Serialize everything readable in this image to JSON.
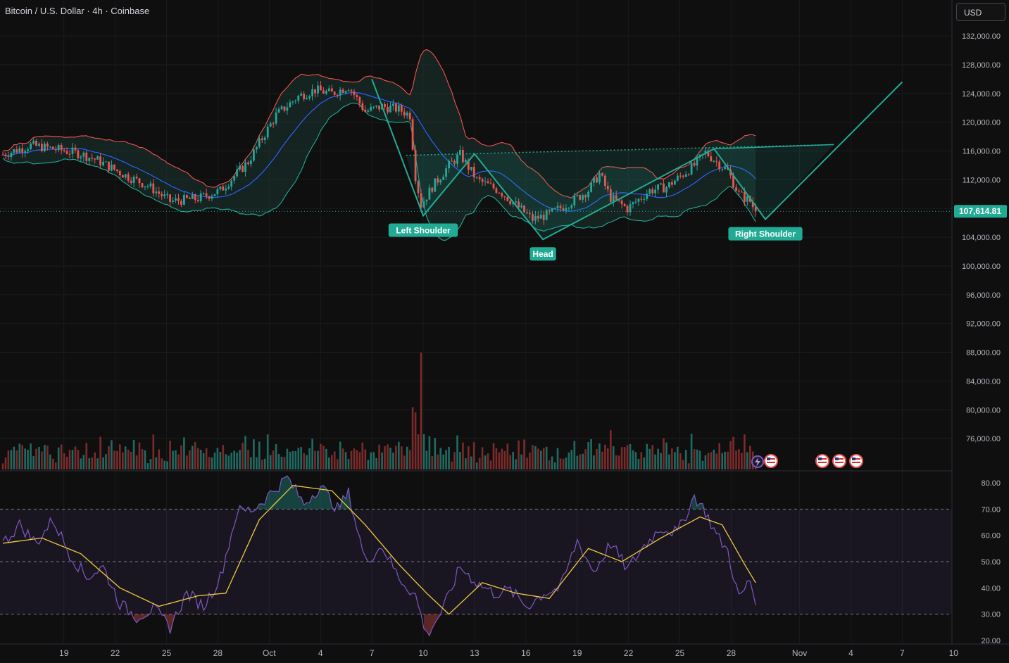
{
  "header": {
    "symbol_title": "Bitcoin / U.S. Dollar · 4h · Coinbase",
    "currency": "USD"
  },
  "colors": {
    "up": "#26a69a",
    "down": "#ef5350",
    "ma": "#2962ff",
    "band": "#ef5350",
    "pattern": "#22ab94",
    "rsi": "#7e57c2",
    "rsi_ma": "#f0c93a",
    "background": "#0f0f0f"
  },
  "last_price": "107,614.81",
  "pattern_labels": {
    "left_shoulder": "Left Shoulder",
    "head": "Head",
    "right_shoulder": "Right Shoulder"
  },
  "chart_data": [
    {
      "type": "candlestick",
      "title": "Bitcoin / U.S. Dollar · 4h · Coinbase",
      "y_ticks": [
        "76,000.00",
        "80,000.00",
        "84,000.00",
        "88,000.00",
        "92,000.00",
        "96,000.00",
        "100,000.00",
        "104,000.00",
        "108,000.00",
        "112,000.00",
        "116,000.00",
        "120,000.00",
        "124,000.00",
        "128,000.00",
        "132,000.00"
      ],
      "ylim": [
        74000,
        135000
      ],
      "x_ticks": [
        "19",
        "22",
        "25",
        "28",
        "Oct",
        "4",
        "7",
        "10",
        "13",
        "16",
        "19",
        "22",
        "25",
        "28",
        "Nov",
        "4",
        "7",
        "10"
      ],
      "price_key_points": [
        {
          "t": 0,
          "p": 115500
        },
        {
          "t": 10,
          "p": 116800
        },
        {
          "t": 20,
          "p": 116200
        },
        {
          "t": 28,
          "p": 115600
        },
        {
          "t": 34,
          "p": 114700
        },
        {
          "t": 44,
          "p": 112600
        },
        {
          "t": 52,
          "p": 111200
        },
        {
          "t": 60,
          "p": 109000
        },
        {
          "t": 70,
          "p": 109400
        },
        {
          "t": 78,
          "p": 110500
        },
        {
          "t": 88,
          "p": 114500
        },
        {
          "t": 98,
          "p": 121000
        },
        {
          "t": 106,
          "p": 123600
        },
        {
          "t": 112,
          "p": 124500
        },
        {
          "t": 118,
          "p": 124000
        },
        {
          "t": 124,
          "p": 125000
        },
        {
          "t": 130,
          "p": 121500
        },
        {
          "t": 136,
          "p": 122200
        },
        {
          "t": 142,
          "p": 121800
        },
        {
          "t": 146,
          "p": 121000
        },
        {
          "t": 148,
          "p": 112500
        },
        {
          "t": 150,
          "p": 108500
        },
        {
          "t": 154,
          "p": 111000
        },
        {
          "t": 160,
          "p": 114000
        },
        {
          "t": 164,
          "p": 115500
        },
        {
          "t": 170,
          "p": 112000
        },
        {
          "t": 178,
          "p": 110500
        },
        {
          "t": 184,
          "p": 108500
        },
        {
          "t": 190,
          "p": 106500
        },
        {
          "t": 196,
          "p": 107200
        },
        {
          "t": 204,
          "p": 109000
        },
        {
          "t": 210,
          "p": 110500
        },
        {
          "t": 214,
          "p": 112800
        },
        {
          "t": 218,
          "p": 109500
        },
        {
          "t": 224,
          "p": 108000
        },
        {
          "t": 232,
          "p": 110500
        },
        {
          "t": 238,
          "p": 111000
        },
        {
          "t": 244,
          "p": 112800
        },
        {
          "t": 248,
          "p": 114000
        },
        {
          "t": 252,
          "p": 115800
        },
        {
          "t": 256,
          "p": 114500
        },
        {
          "t": 260,
          "p": 113200
        },
        {
          "t": 264,
          "p": 110000
        },
        {
          "t": 268,
          "p": 109000
        },
        {
          "t": 270,
          "p": 107614
        }
      ],
      "volume_spike_time_index": 150,
      "pattern": {
        "name": "Inverse head and shoulders",
        "points": [
          {
            "day": "Oct 7",
            "p": 126000
          },
          {
            "day": "Oct 10",
            "p": 107000
          },
          {
            "day": "Oct 13",
            "p": 115600
          },
          {
            "day": "Oct 17",
            "p": 103700
          },
          {
            "day": "Oct 27",
            "p": 116300
          },
          {
            "day": "Oct 30",
            "p": 106500
          },
          {
            "day": "Nov 7",
            "p": 125600
          }
        ],
        "neckline": {
          "from_day": "Oct 9",
          "to_day": "Nov 3",
          "p_start": 115400,
          "p_end": 116900
        },
        "labels": [
          "Left Shoulder",
          "Head",
          "Right Shoulder"
        ]
      },
      "last_price": 107614.81
    },
    {
      "type": "line",
      "name": "RSI",
      "ylim": [
        18,
        82
      ],
      "y_ticks": [
        "20.00",
        "30.00",
        "40.00",
        "50.00",
        "60.00",
        "70.00",
        "80.00"
      ],
      "band": [
        30,
        70
      ],
      "midline": 50,
      "rsi_key_points": [
        {
          "t": 0,
          "v": 57
        },
        {
          "t": 6,
          "v": 64
        },
        {
          "t": 12,
          "v": 57
        },
        {
          "t": 18,
          "v": 66
        },
        {
          "t": 24,
          "v": 53
        },
        {
          "t": 30,
          "v": 44
        },
        {
          "t": 36,
          "v": 48
        },
        {
          "t": 42,
          "v": 34
        },
        {
          "t": 48,
          "v": 29
        },
        {
          "t": 54,
          "v": 32
        },
        {
          "t": 60,
          "v": 25
        },
        {
          "t": 66,
          "v": 38
        },
        {
          "t": 72,
          "v": 33
        },
        {
          "t": 78,
          "v": 44
        },
        {
          "t": 84,
          "v": 69
        },
        {
          "t": 90,
          "v": 70
        },
        {
          "t": 96,
          "v": 76
        },
        {
          "t": 102,
          "v": 82
        },
        {
          "t": 108,
          "v": 72
        },
        {
          "t": 114,
          "v": 79
        },
        {
          "t": 120,
          "v": 70
        },
        {
          "t": 124,
          "v": 76
        },
        {
          "t": 130,
          "v": 50
        },
        {
          "t": 136,
          "v": 56
        },
        {
          "t": 142,
          "v": 44
        },
        {
          "t": 148,
          "v": 37
        },
        {
          "t": 152,
          "v": 22
        },
        {
          "t": 158,
          "v": 32
        },
        {
          "t": 164,
          "v": 48
        },
        {
          "t": 170,
          "v": 42
        },
        {
          "t": 176,
          "v": 38
        },
        {
          "t": 182,
          "v": 39
        },
        {
          "t": 188,
          "v": 33
        },
        {
          "t": 194,
          "v": 38
        },
        {
          "t": 200,
          "v": 40
        },
        {
          "t": 206,
          "v": 58
        },
        {
          "t": 212,
          "v": 46
        },
        {
          "t": 218,
          "v": 57
        },
        {
          "t": 224,
          "v": 47
        },
        {
          "t": 230,
          "v": 56
        },
        {
          "t": 236,
          "v": 63
        },
        {
          "t": 242,
          "v": 61
        },
        {
          "t": 248,
          "v": 75
        },
        {
          "t": 252,
          "v": 69
        },
        {
          "t": 256,
          "v": 60
        },
        {
          "t": 260,
          "v": 54
        },
        {
          "t": 264,
          "v": 36
        },
        {
          "t": 268,
          "v": 43
        },
        {
          "t": 270,
          "v": 34
        }
      ],
      "rsi_ma_key_points": [
        {
          "t": 0,
          "v": 57
        },
        {
          "t": 14,
          "v": 59
        },
        {
          "t": 28,
          "v": 53
        },
        {
          "t": 42,
          "v": 40
        },
        {
          "t": 56,
          "v": 33
        },
        {
          "t": 70,
          "v": 37
        },
        {
          "t": 80,
          "v": 38
        },
        {
          "t": 92,
          "v": 66
        },
        {
          "t": 104,
          "v": 79
        },
        {
          "t": 118,
          "v": 77
        },
        {
          "t": 130,
          "v": 64
        },
        {
          "t": 142,
          "v": 49
        },
        {
          "t": 152,
          "v": 38
        },
        {
          "t": 160,
          "v": 30
        },
        {
          "t": 172,
          "v": 42
        },
        {
          "t": 184,
          "v": 38
        },
        {
          "t": 196,
          "v": 36
        },
        {
          "t": 210,
          "v": 55
        },
        {
          "t": 222,
          "v": 50
        },
        {
          "t": 236,
          "v": 59
        },
        {
          "t": 250,
          "v": 67
        },
        {
          "t": 258,
          "v": 64
        },
        {
          "t": 266,
          "v": 49
        },
        {
          "t": 270,
          "v": 42
        }
      ]
    }
  ]
}
